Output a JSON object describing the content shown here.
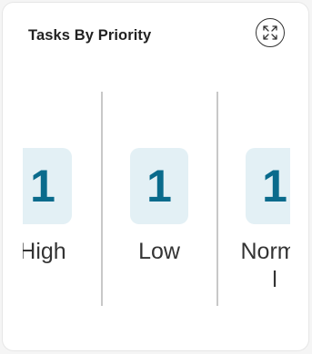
{
  "widget": {
    "title": "Tasks By Priority",
    "expand_icon": "expand-arrows-icon"
  },
  "priorities": [
    {
      "label": "High",
      "count": "1"
    },
    {
      "label": "Low",
      "count": "1"
    },
    {
      "label": "Normal",
      "count": "1"
    }
  ],
  "colors": {
    "count_text": "#0a6b8c",
    "count_bg": "#e3f0f5",
    "divider": "#c8c8c8"
  }
}
